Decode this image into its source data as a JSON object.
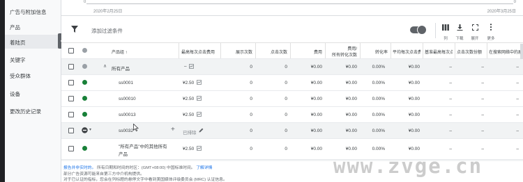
{
  "sidebar": {
    "items": [
      {
        "label": "广告与附加信息"
      },
      {
        "label": "产品"
      },
      {
        "label": "着陆页"
      },
      {
        "label": "关键字"
      },
      {
        "label": "受众群体"
      },
      {
        "label": "设备"
      },
      {
        "label": "更改历史记录"
      }
    ]
  },
  "timeline": {
    "start": "2020年2月25日",
    "end": "2020年3月25日",
    "start_val": "0",
    "end_val": "0"
  },
  "toolbar": {
    "filter_label": "添加过滤条件",
    "columns_label": "列",
    "download_label": "下载",
    "expand_label": "展开",
    "more_label": "更多"
  },
  "table": {
    "headers": {
      "product_group": "产品组 ↑",
      "max_cpc": "最高每次点击费用",
      "impressions": "展示次数",
      "clicks": "点击次数",
      "cost": "费用",
      "cost_per_conv_1": "费用/",
      "cost_per_conv_2": "所有转化次数",
      "conv_rate": "转化率",
      "avg_cpc": "平均每次点击费用",
      "bench_cpc": "基准最高每次点击费用",
      "click_share": "点击次数份额",
      "search_imp_share": "在搜索网络中的展示次数份额"
    },
    "rows": [
      {
        "name": "所有产品",
        "max_cpc": "–",
        "impressions": "0",
        "clicks": "0",
        "cost": "¥0.00",
        "cost_conv": "¥0.00",
        "conv_rate": "0.00%",
        "avg_cpc": "¥0.00",
        "bench": "–",
        "share": "–",
        "search": "–"
      },
      {
        "name": "ss0001",
        "max_cpc": "¥2.50",
        "impressions": "0",
        "clicks": "0",
        "cost": "¥0.00",
        "cost_conv": "¥0.00",
        "conv_rate": "0.00%",
        "avg_cpc": "¥0.00",
        "bench": "–",
        "share": "–",
        "search": "–"
      },
      {
        "name": "ss00010",
        "max_cpc": "¥2.50",
        "impressions": "0",
        "clicks": "0",
        "cost": "¥0.00",
        "cost_conv": "¥0.00",
        "conv_rate": "0.00%",
        "avg_cpc": "¥0.00",
        "bench": "–",
        "share": "–",
        "search": "–"
      },
      {
        "name": "ss00013",
        "max_cpc": "¥2.50",
        "impressions": "0",
        "clicks": "0",
        "cost": "¥0.00",
        "cost_conv": "¥0.00",
        "conv_rate": "0.00%",
        "avg_cpc": "¥0.00",
        "bench": "–",
        "share": "–",
        "search": "–"
      },
      {
        "name": "ss0032",
        "max_cpc": "已排除",
        "impressions": "0",
        "clicks": "0",
        "cost": "¥0.00",
        "cost_conv": "¥0.00",
        "conv_rate": "0.00%",
        "avg_cpc": "¥0.00",
        "bench": "–",
        "share": "–",
        "search": "–"
      },
      {
        "name_1": "\"所有产品\"中的其他所有",
        "name_2": "产品",
        "max_cpc": "¥2.50",
        "impressions": "0",
        "clicks": "0",
        "cost": "¥0.00",
        "cost_conv": "¥0.00",
        "conv_rate": "0.00%",
        "avg_cpc": "¥0.00",
        "bench": "–",
        "share": "–",
        "search": "–"
      }
    ]
  },
  "footer": {
    "line1_link": "报告并非实时的。",
    "line1_text": "所有日期和时间的时区：(GMT+08:00) 中国标准时间。",
    "line1_more": "了解详情",
    "line2": "部分广告资源可能来自第三方中介机构提供。",
    "line3": "对于已认证的指标，您会在列标题的悬停文字中看到美国媒体评级委员会 (MRC) 认证信息。"
  },
  "watermark": "www.zvge.cn"
}
